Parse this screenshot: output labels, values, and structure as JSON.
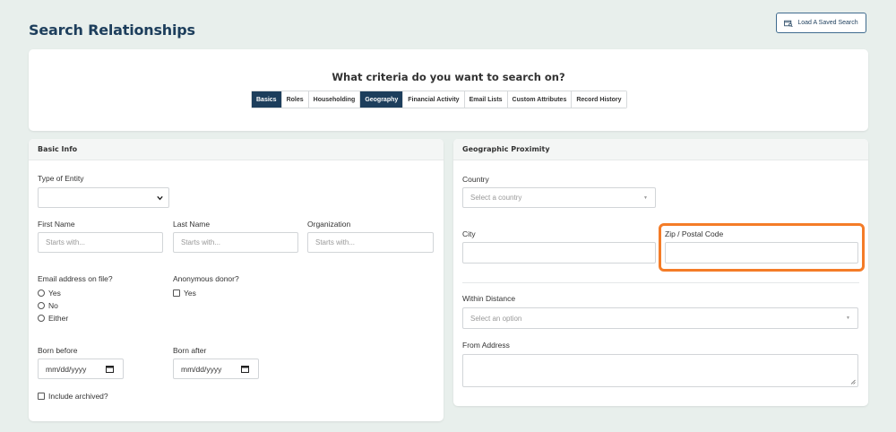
{
  "header": {
    "title": "Search Relationships",
    "load_button_label": "Load A Saved Search"
  },
  "criteria": {
    "title": "What criteria do you want to search on?",
    "tabs": [
      {
        "label": "Basics",
        "active": true
      },
      {
        "label": "Roles",
        "active": false
      },
      {
        "label": "Householding",
        "active": false
      },
      {
        "label": "Geography",
        "active": true
      },
      {
        "label": "Financial Activity",
        "active": false
      },
      {
        "label": "Email Lists",
        "active": false
      },
      {
        "label": "Custom Attributes",
        "active": false
      },
      {
        "label": "Record History",
        "active": false
      }
    ]
  },
  "basic_info": {
    "header": "Basic Info",
    "type_of_entity_label": "Type of Entity",
    "type_of_entity_value": "",
    "first_name_label": "First Name",
    "first_name_placeholder": "Starts with...",
    "last_name_label": "Last Name",
    "last_name_placeholder": "Starts with...",
    "organization_label": "Organization",
    "organization_placeholder": "Starts with...",
    "email_label": "Email address on file?",
    "email_options": [
      "Yes",
      "No",
      "Either"
    ],
    "anonymous_label": "Anonymous donor?",
    "anonymous_option": "Yes",
    "born_before_label": "Born before",
    "born_before_value": "mm/dd/yyyy",
    "born_after_label": "Born after",
    "born_after_value": "mm/dd/yyyy",
    "include_archived_label": "Include archived?"
  },
  "geo": {
    "header": "Geographic Proximity",
    "country_label": "Country",
    "country_placeholder": "Select a country",
    "city_label": "City",
    "city_value": "",
    "zip_label": "Zip / Postal Code",
    "zip_value": "",
    "distance_label": "Within Distance",
    "distance_placeholder": "Select an option",
    "from_address_label": "From Address",
    "from_address_value": ""
  },
  "colors": {
    "brand_navy": "#1d3e5c",
    "highlight_orange": "#f47c28",
    "page_bg": "#e8efec"
  }
}
